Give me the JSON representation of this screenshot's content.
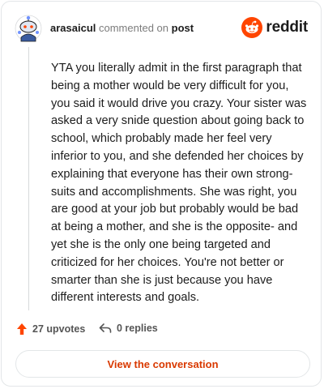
{
  "header": {
    "username": "arasaicul",
    "action_text": "commented on",
    "post_link": "post",
    "brand": "reddit",
    "brand_color": "#ff4500"
  },
  "comment": {
    "text": "YTA you literally admit in the first paragraph that being a mother would be very difficult for you, you said it would drive you crazy. Your sister was asked a very snide question about going back to school, which probably made her feel very inferior to you, and she defended her choices by explaining that everyone has their own strong-suits and accomplishments. She was right, you are good at your job but probably would be bad at being a mother, and she is the opposite- and yet she is the only one being targeted and criticized for her choices. You're not better or smarter than she is just because you have different interests and goals."
  },
  "footer": {
    "upvotes": "27 upvotes",
    "replies": "0 replies",
    "upvote_icon": "upvote-arrow-icon",
    "reply_icon": "reply-arrow-icon"
  },
  "cta": {
    "label": "View the conversation"
  }
}
